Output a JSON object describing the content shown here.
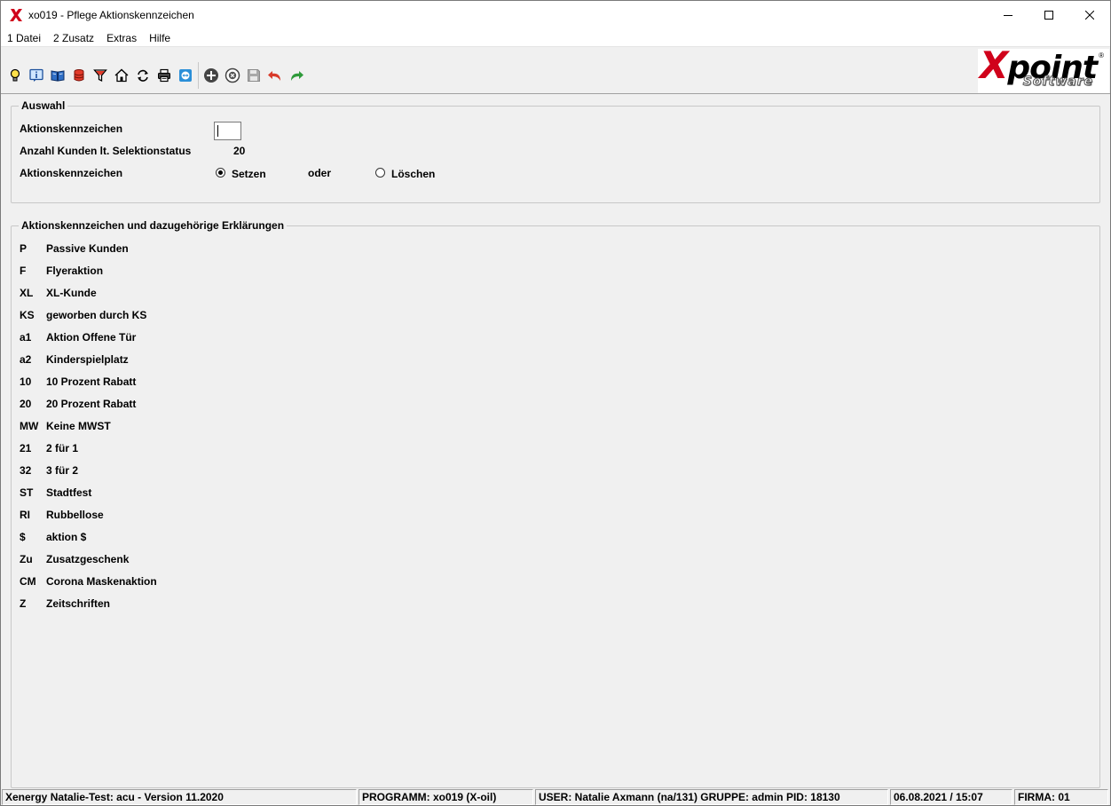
{
  "window": {
    "title": "xo019 - Pflege Aktionskennzeichen",
    "controls": [
      "minimize-icon",
      "maximize-icon",
      "close-icon"
    ]
  },
  "menu": {
    "items": [
      "1 Datei",
      "2 Zusatz",
      "Extras",
      "Hilfe"
    ]
  },
  "toolbar": {
    "icons": [
      "lightbulb-icon",
      "info-icon",
      "book-icon",
      "database-icon",
      "filter-icon",
      "home-icon",
      "refresh-icon",
      "print-icon",
      "remote-icon",
      "add-icon",
      "cancel-icon",
      "save-icon",
      "undo-icon",
      "redo-icon"
    ]
  },
  "logo": {
    "brand_x": "X",
    "brand_rest": "point",
    "sub": "Software",
    "registered": "®"
  },
  "auswahl": {
    "title": "Auswahl",
    "aktionskennzeichen_label": "Aktionskennzeichen",
    "aktionskennzeichen_value": "",
    "anzahl_label": "Anzahl Kunden lt. Selektionstatus",
    "anzahl_value": "20",
    "aktion_label": "Aktionskennzeichen",
    "option_setzen": "Setzen",
    "oder": "oder",
    "option_loeschen": "Löschen",
    "selected": "Setzen"
  },
  "erklaerungen": {
    "title": "Aktionskennzeichen und dazugehörige Erklärungen",
    "items": [
      {
        "code": "P",
        "desc": "Passive Kunden"
      },
      {
        "code": "F",
        "desc": "Flyeraktion"
      },
      {
        "code": "XL",
        "desc": "XL-Kunde"
      },
      {
        "code": "KS",
        "desc": "geworben durch KS"
      },
      {
        "code": "a1",
        "desc": "Aktion Offene Tür"
      },
      {
        "code": "a2",
        "desc": "Kinderspielplatz"
      },
      {
        "code": "10",
        "desc": "10 Prozent Rabatt"
      },
      {
        "code": "20",
        "desc": "20 Prozent Rabatt"
      },
      {
        "code": "MW",
        "desc": "Keine MWST"
      },
      {
        "code": "21",
        "desc": "2 für 1"
      },
      {
        "code": "32",
        "desc": "3 für 2"
      },
      {
        "code": "ST",
        "desc": "Stadtfest"
      },
      {
        "code": "RI",
        "desc": "Rubbellose"
      },
      {
        "code": "$",
        "desc": "aktion $"
      },
      {
        "code": "Zu",
        "desc": "Zusatzgeschenk"
      },
      {
        "code": "CM",
        "desc": "Corona Maskenaktion"
      },
      {
        "code": "Z",
        "desc": "Zeitschriften"
      }
    ]
  },
  "statusbar": {
    "version": "Xenergy Natalie-Test: acu - Version 11.2020",
    "programm": "PROGRAMM: xo019 (X-oil)",
    "user": "USER: Natalie Axmann (na/131)  GRUPPE: admin  PID: 18130",
    "datetime": "06.08.2021 / 15:07",
    "firma": "FIRMA: 01"
  },
  "colors": {
    "background": "#f0f0f0",
    "logo_red": "#d0021b",
    "undo_red": "#d83a2a",
    "redo_green": "#2e9a3a"
  }
}
